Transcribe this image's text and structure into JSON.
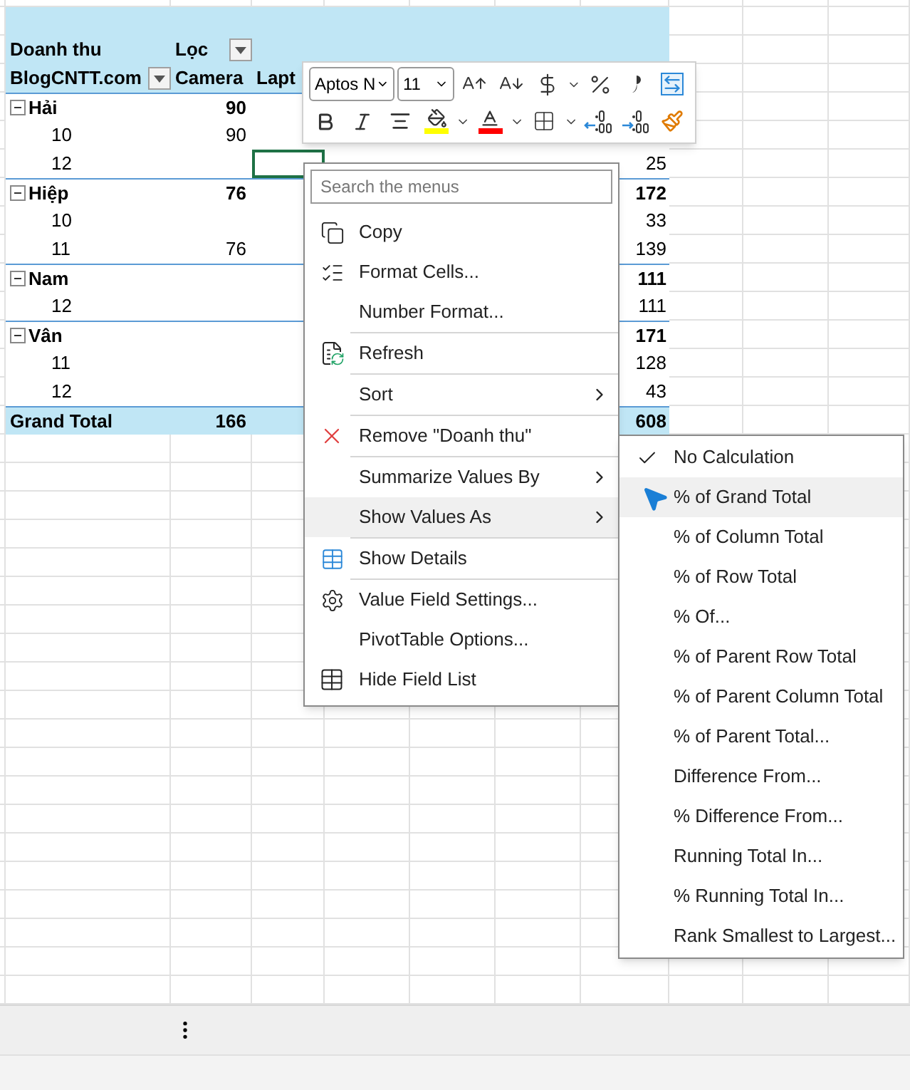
{
  "pivot": {
    "value_label": "Doanh thu",
    "filter_label": "Lọc",
    "row_field": "BlogCNTT.com",
    "columns": [
      "Camera",
      "Lapt"
    ],
    "rows": [
      {
        "kind": "group",
        "label": "Hải",
        "expanded": true,
        "camera": "90",
        "selected": false
      },
      {
        "kind": "item",
        "label": "10",
        "camera": "90",
        "selected": false
      },
      {
        "kind": "item",
        "label": "12",
        "total": "25",
        "selected": true
      },
      {
        "kind": "group",
        "label": "Hiệp",
        "expanded": true,
        "camera": "76",
        "total": "172",
        "selected": false
      },
      {
        "kind": "item",
        "label": "10",
        "total": "33",
        "selected": false
      },
      {
        "kind": "item",
        "label": "11",
        "camera": "76",
        "total": "139",
        "selected": false
      },
      {
        "kind": "group",
        "label": "Nam",
        "expanded": true,
        "total": "111",
        "selected": false
      },
      {
        "kind": "item",
        "label": "12",
        "total": "111",
        "selected": false
      },
      {
        "kind": "group",
        "label": "Vân",
        "expanded": true,
        "total": "171",
        "selected": false
      },
      {
        "kind": "item",
        "label": "11",
        "total": "128",
        "selected": false
      },
      {
        "kind": "item",
        "label": "12",
        "total": "43",
        "selected": false
      }
    ],
    "grand_total": {
      "label": "Grand Total",
      "camera": "166",
      "total": "608"
    }
  },
  "mini_toolbar": {
    "font": "Aptos N",
    "size": "11"
  },
  "context_menu": {
    "search": {
      "placeholder": "Search the menus"
    },
    "groups": [
      [
        {
          "label": "Copy",
          "kind": "item",
          "selected": false
        },
        {
          "label": "Format Cells...",
          "kind": "item",
          "selected": false
        },
        {
          "label": "Number Format...",
          "kind": "item",
          "selected": false
        }
      ],
      [
        {
          "label": "Refresh",
          "kind": "item",
          "selected": false
        }
      ],
      [
        {
          "label": "Sort",
          "kind": "submenu",
          "selected": false
        }
      ],
      [
        {
          "label": "Remove \"Doanh thu\"",
          "kind": "item",
          "selected": false
        }
      ],
      [
        {
          "label": "Summarize Values By",
          "kind": "submenu",
          "selected": false
        },
        {
          "label": "Show Values As",
          "kind": "submenu",
          "selected": true
        }
      ],
      [
        {
          "label": "Show Details",
          "kind": "item",
          "selected": false
        }
      ],
      [
        {
          "label": "Value Field Settings...",
          "kind": "item",
          "selected": false
        },
        {
          "label": "PivotTable Options...",
          "kind": "item",
          "selected": false
        },
        {
          "label": "Hide Field List",
          "kind": "item",
          "selected": false
        }
      ]
    ]
  },
  "submenu": {
    "items": [
      {
        "label": "No Calculation",
        "checked": true,
        "selected": false
      },
      {
        "label": "% of Grand Total",
        "checked": false,
        "selected": true
      },
      {
        "label": "% of Column Total",
        "checked": false,
        "selected": false
      },
      {
        "label": "% of Row Total",
        "checked": false,
        "selected": false
      },
      {
        "label": "% Of...",
        "checked": false,
        "selected": false
      },
      {
        "label": "% of Parent Row Total",
        "checked": false,
        "selected": false
      },
      {
        "label": "% of Parent Column Total",
        "checked": false,
        "selected": false
      },
      {
        "label": "% of Parent Total...",
        "checked": false,
        "selected": false
      },
      {
        "label": "Difference From...",
        "checked": false,
        "selected": false
      },
      {
        "label": "% Difference From...",
        "checked": false,
        "selected": false
      },
      {
        "label": "Running Total In...",
        "checked": false,
        "selected": false
      },
      {
        "label": "% Running Total In...",
        "checked": false,
        "selected": false
      },
      {
        "label": "Rank Smallest to Largest...",
        "checked": false,
        "selected": false
      }
    ]
  }
}
